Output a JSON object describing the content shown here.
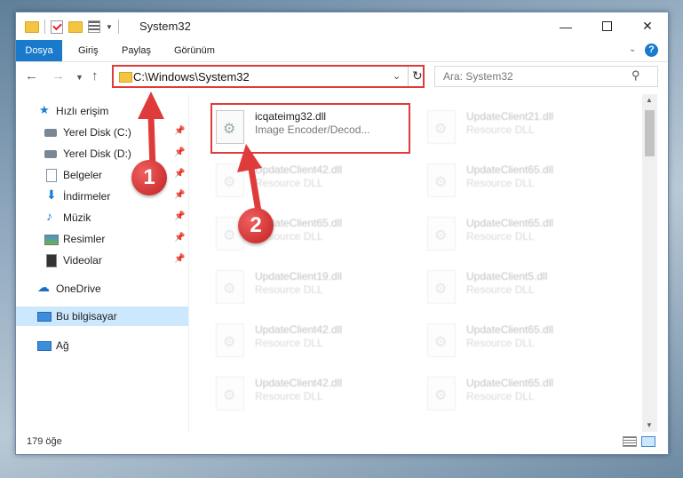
{
  "window": {
    "title": "System32",
    "controls": {
      "minimize": "—",
      "maximize": "",
      "close": "✕"
    }
  },
  "ribbon": {
    "tabs": [
      "Dosya",
      "Giriş",
      "Paylaş",
      "Görünüm"
    ],
    "help": "?",
    "collapse": "⌄"
  },
  "nav": {
    "back": "←",
    "forward": "→",
    "recent": "⌄",
    "up": "↑",
    "address": "C:\\Windows\\System32",
    "address_dropdown": "⌄",
    "refresh": "↻",
    "search_placeholder": "Ara: System32",
    "search_icon": "⚲"
  },
  "sidebar": {
    "items": [
      {
        "label": "Hızlı erişim",
        "icon": "star-icon",
        "pinned": false
      },
      {
        "label": "Yerel Disk (C:)",
        "icon": "drive-icon",
        "pinned": true
      },
      {
        "label": "Yerel Disk (D:)",
        "icon": "drive-icon",
        "pinned": true
      },
      {
        "label": "Belgeler",
        "icon": "document-icon",
        "pinned": true
      },
      {
        "label": "İndirmeler",
        "icon": "download-icon",
        "pinned": true
      },
      {
        "label": "Müzik",
        "icon": "music-icon",
        "pinned": true
      },
      {
        "label": "Resimler",
        "icon": "pictures-icon",
        "pinned": true
      },
      {
        "label": "Videolar",
        "icon": "video-icon",
        "pinned": true
      },
      {
        "label": "OneDrive",
        "icon": "cloud-icon",
        "pinned": false
      },
      {
        "label": "Bu bilgisayar",
        "icon": "computer-icon",
        "pinned": false,
        "selected": true
      },
      {
        "label": "Ağ",
        "icon": "network-icon",
        "pinned": false
      }
    ],
    "pin_glyph": "📌"
  },
  "files": [
    {
      "name": "icqateimg32.dll",
      "desc": "Image Encoder/Decod...",
      "highlighted": true
    },
    {
      "name": "UpdateClient21.dll",
      "desc": "Resource DLL"
    },
    {
      "name": "UpdateClient42.dll",
      "desc": "Resource DLL"
    },
    {
      "name": "UpdateClient65.dll",
      "desc": "Resource DLL"
    },
    {
      "name": "UpdateClient65.dll",
      "desc": "Resource DLL"
    },
    {
      "name": "UpdateClient65.dll",
      "desc": "Resource DLL"
    },
    {
      "name": "UpdateClient19.dll",
      "desc": "Resource DLL"
    },
    {
      "name": "UpdateClient5.dll",
      "desc": "Resource DLL"
    },
    {
      "name": "UpdateClient42.dll",
      "desc": "Resource DLL"
    },
    {
      "name": "UpdateClient65.dll",
      "desc": "Resource DLL"
    },
    {
      "name": "UpdateClient42.dll",
      "desc": "Resource DLL"
    },
    {
      "name": "UpdateClient65.dll",
      "desc": "Resource DLL"
    }
  ],
  "status": {
    "count": "179 öğe"
  },
  "annotations": {
    "step1": "1",
    "step2": "2",
    "color": "#e03b3b"
  }
}
